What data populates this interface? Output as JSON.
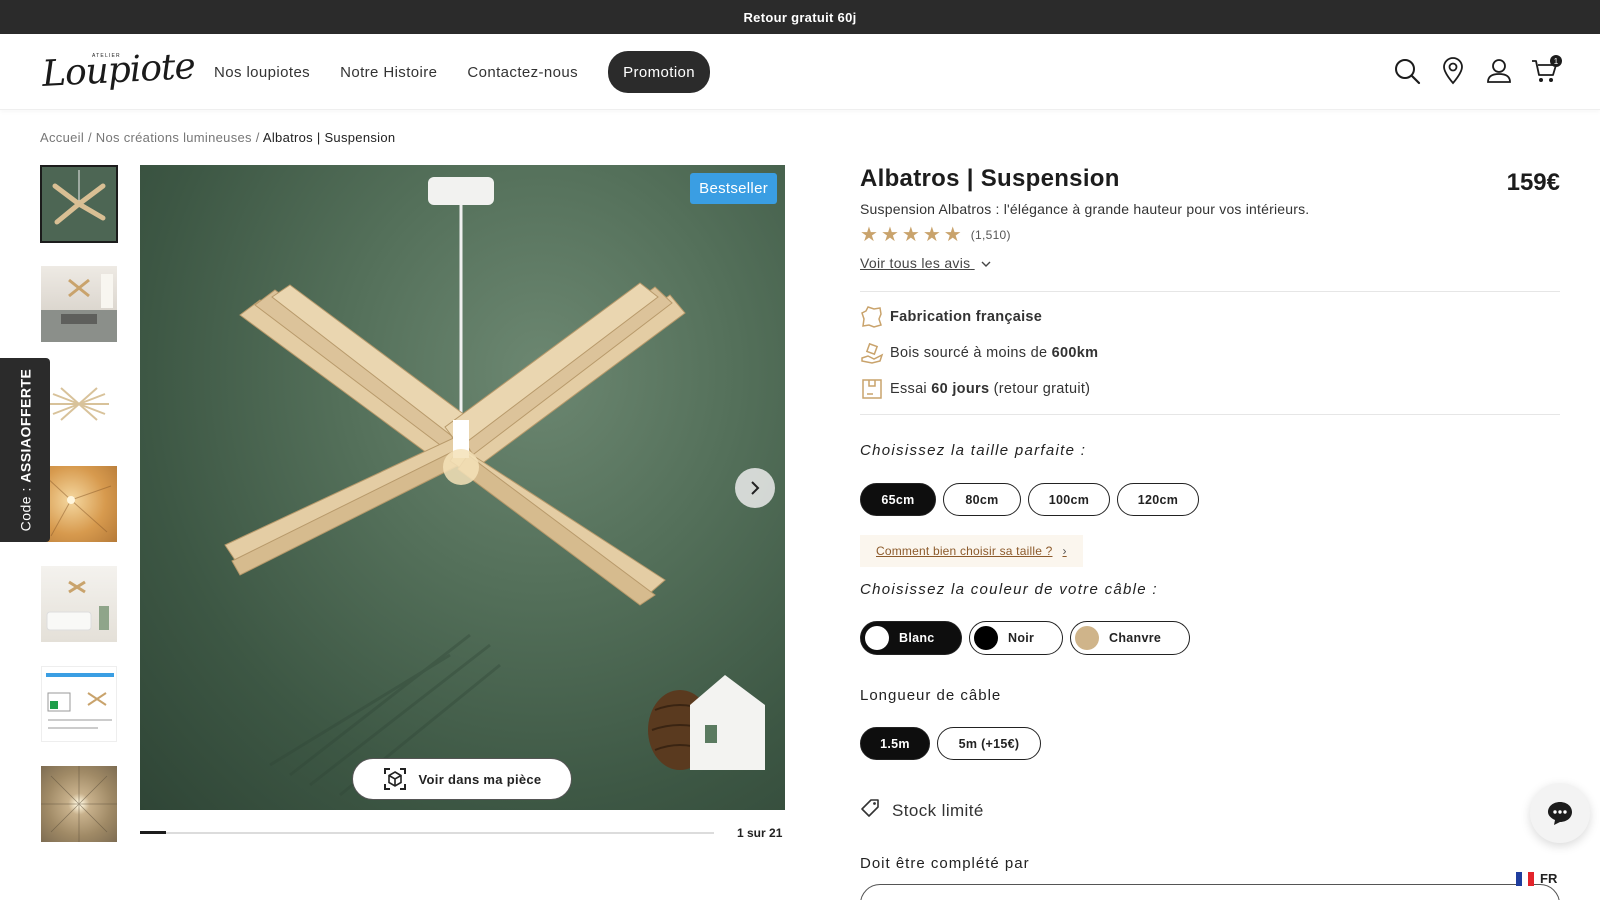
{
  "banner": {
    "text": "Retour gratuit 60j"
  },
  "header": {
    "logo_small": "ATELIER",
    "logo_script": "Loupiote",
    "nav": [
      {
        "label": "Nos loupiotes"
      },
      {
        "label": "Notre Histoire"
      },
      {
        "label": "Contactez-nous"
      }
    ],
    "promo_label": "Promotion",
    "icons": [
      "search-icon",
      "location-pin-icon",
      "account-icon",
      "cart-icon"
    ],
    "cart_count": "1"
  },
  "breadcrumb": {
    "items": [
      "Accueil",
      "Nos créations lumineuses"
    ],
    "separator": "/",
    "current": "Albatros | Suspension"
  },
  "side_code": {
    "prefix": "Code : ",
    "code": "ASSIAOFFERTE"
  },
  "gallery": {
    "badge": "Bestseller",
    "ar_button": "Voir dans ma pièce",
    "pager": "1 sur 21",
    "progress": 0.045,
    "thumbnail_count": 7
  },
  "product": {
    "title": "Albatros | Suspension",
    "price": "159€",
    "subtitle": "Suspension Albatros : l'élégance à grande hauteur pour vos intérieurs.",
    "rating": 5,
    "review_count": "(1,510)",
    "reviews_link": "Voir tous les avis",
    "features": [
      {
        "icon": "france-map-icon",
        "pre": "",
        "bold": "Fabrication française",
        "post": ""
      },
      {
        "icon": "hand-wood-icon",
        "pre": "Bois sourcé à moins de ",
        "bold": "600km",
        "post": ""
      },
      {
        "icon": "box-return-icon",
        "pre": "Essai ",
        "bold": "60 jours",
        "post": " (retour gratuit)"
      }
    ],
    "size_title": "Choisissez la taille parfaite :",
    "sizes": [
      "65cm",
      "80cm",
      "100cm",
      "120cm"
    ],
    "size_selected": "65cm",
    "size_help": "Comment bien choisir sa taille ?",
    "cable_color_title": "Choisissez la couleur de votre câble :",
    "cable_colors": [
      {
        "label": "Blanc",
        "swatch": "#ffffff"
      },
      {
        "label": "Noir",
        "swatch": "#000000"
      },
      {
        "label": "Chanvre",
        "swatch": "#cfb48a"
      }
    ],
    "cable_color_selected": "Blanc",
    "cable_length_title": "Longueur de câble",
    "cable_lengths": [
      "1.5m",
      "5m (+15€)"
    ],
    "cable_length_selected": "1.5m",
    "stock": "Stock limité",
    "complete_label": "Doit être complété par"
  },
  "language": {
    "code": "FR"
  },
  "colors": {
    "accent_dark": "#2b2b2b",
    "badge_blue": "#3a9ee3",
    "star_gold": "#c9a36c",
    "helper_bg": "#fbf6ee"
  }
}
